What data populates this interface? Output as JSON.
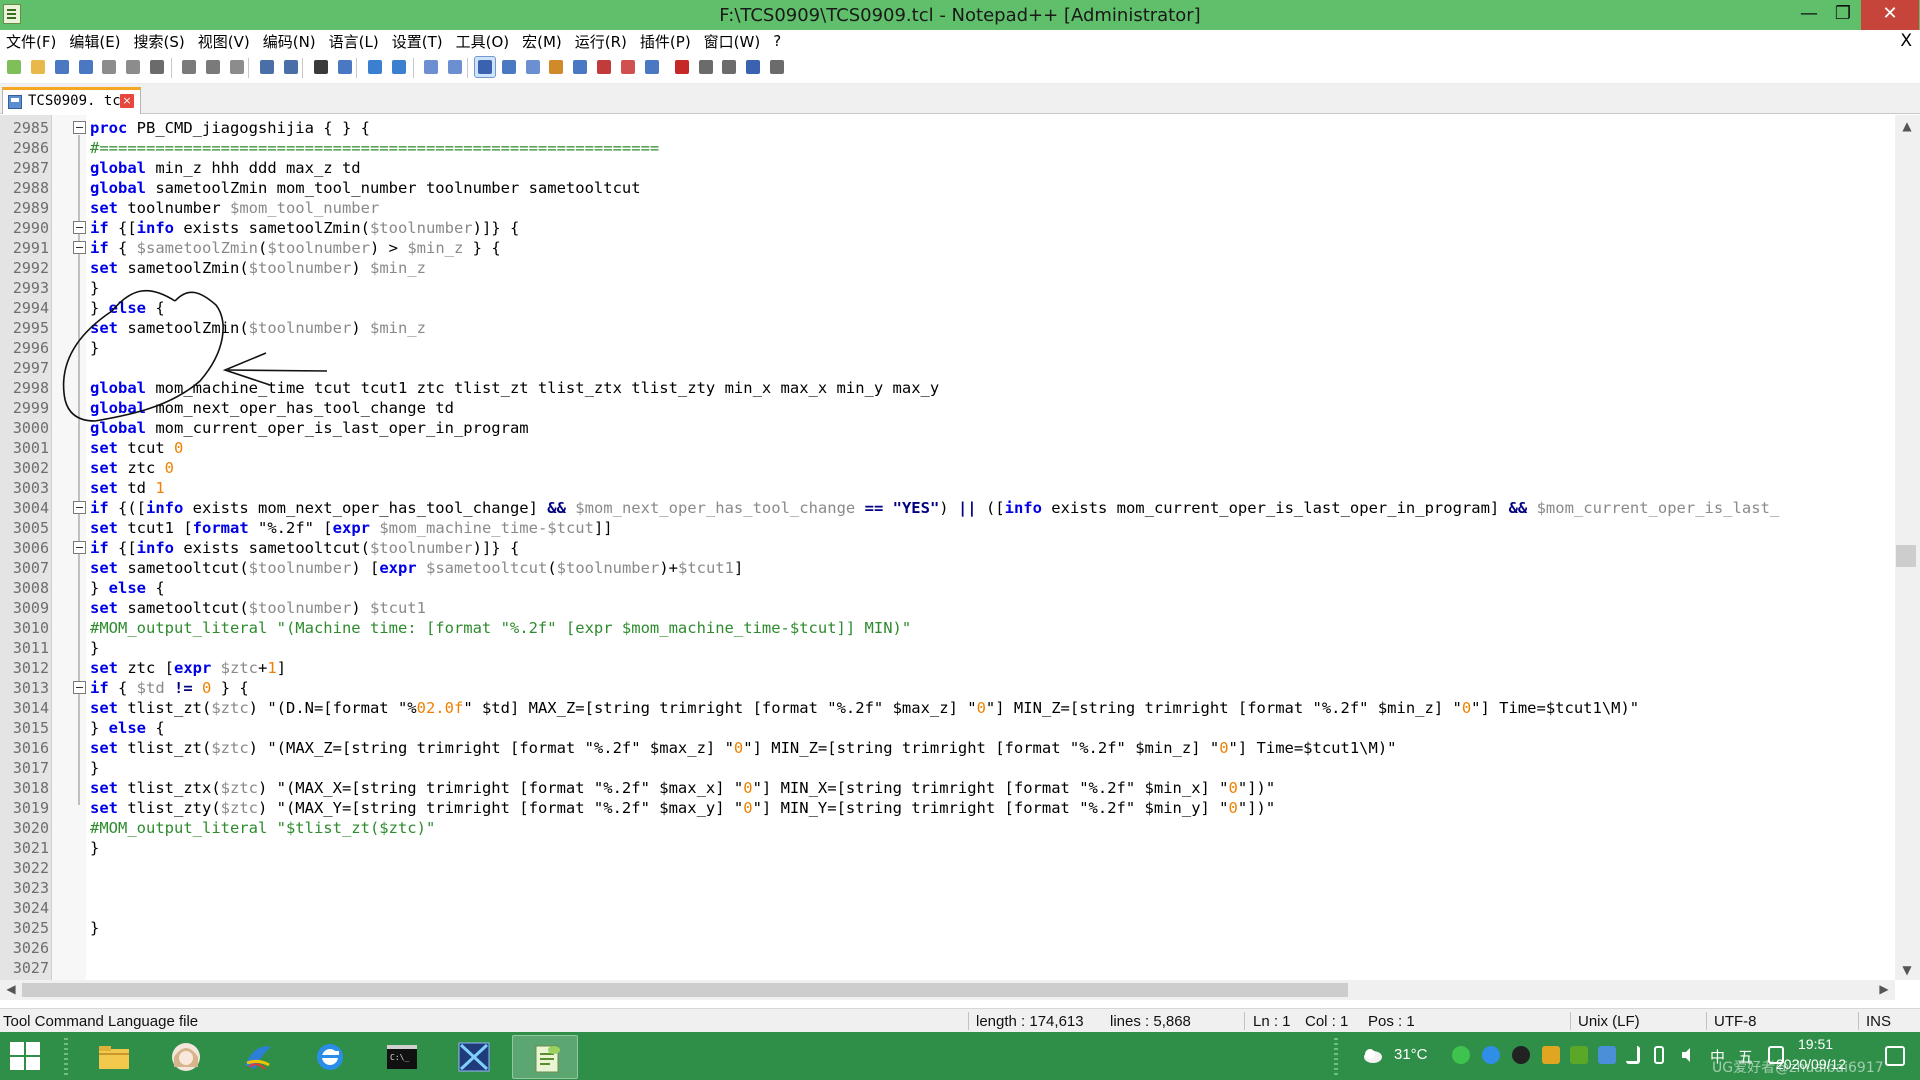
{
  "window": {
    "title": "F:\\TCS0909\\TCS0909.tcl - Notepad++ [Administrator]",
    "min_glyph": "—",
    "max_glyph": "❐",
    "close_glyph": "✕"
  },
  "menu": {
    "items": [
      "文件(F)",
      "编辑(E)",
      "搜索(S)",
      "视图(V)",
      "编码(N)",
      "语言(L)",
      "设置(T)",
      "工具(O)",
      "宏(M)",
      "运行(R)",
      "插件(P)",
      "窗口(W)",
      "?"
    ],
    "close_glyph": "X"
  },
  "tab": {
    "label": "TCS0909. tcl",
    "close_glyph": "×"
  },
  "editor": {
    "lines": [
      {
        "n": "2985",
        "fold": true
      },
      {
        "n": "2986",
        "fold": false
      },
      {
        "n": "2987",
        "fold": false
      },
      {
        "n": "2988",
        "fold": false
      },
      {
        "n": "2989",
        "fold": false
      },
      {
        "n": "2990",
        "fold": true
      },
      {
        "n": "2991",
        "fold": true
      },
      {
        "n": "2992",
        "fold": false
      },
      {
        "n": "2993",
        "fold": false
      },
      {
        "n": "2994",
        "fold": false
      },
      {
        "n": "2995",
        "fold": false
      },
      {
        "n": "2996",
        "fold": false
      },
      {
        "n": "2997",
        "fold": false
      },
      {
        "n": "2998",
        "fold": false
      },
      {
        "n": "2999",
        "fold": false
      },
      {
        "n": "3000",
        "fold": false
      },
      {
        "n": "3001",
        "fold": false
      },
      {
        "n": "3002",
        "fold": false
      },
      {
        "n": "3003",
        "fold": false
      },
      {
        "n": "3004",
        "fold": true
      },
      {
        "n": "3005",
        "fold": false
      },
      {
        "n": "3006",
        "fold": true
      },
      {
        "n": "3007",
        "fold": false
      },
      {
        "n": "3008",
        "fold": false
      },
      {
        "n": "3009",
        "fold": false
      },
      {
        "n": "3010",
        "fold": false
      },
      {
        "n": "3011",
        "fold": false
      },
      {
        "n": "3012",
        "fold": false
      },
      {
        "n": "3013",
        "fold": true
      },
      {
        "n": "3014",
        "fold": false
      },
      {
        "n": "3015",
        "fold": false
      },
      {
        "n": "3016",
        "fold": false
      },
      {
        "n": "3017",
        "fold": false
      },
      {
        "n": "3018",
        "fold": false
      },
      {
        "n": "3019",
        "fold": false
      },
      {
        "n": "3020",
        "fold": false
      },
      {
        "n": "3021",
        "fold": false
      },
      {
        "n": "3022",
        "fold": false
      },
      {
        "n": "3023",
        "fold": false
      },
      {
        "n": "3024",
        "fold": false
      },
      {
        "n": "3025",
        "fold": false
      },
      {
        "n": "3026",
        "fold": false
      },
      {
        "n": "3027",
        "fold": false
      }
    ],
    "code": [
      [
        [
          "kw",
          "proc"
        ],
        [
          "t",
          " PB_CMD_jiagogshijia { } {"
        ]
      ],
      [
        [
          "cmt",
          "#============================================================"
        ]
      ],
      [
        [
          "kw",
          "global"
        ],
        [
          "t",
          " min_z hhh ddd max_z td"
        ]
      ],
      [
        [
          "kw",
          "global"
        ],
        [
          "t",
          " sametoolZmin mom_tool_number toolnumber sametooltcut"
        ]
      ],
      [
        [
          "kw",
          "set"
        ],
        [
          "t",
          " toolnumber "
        ],
        [
          "var",
          "$mom_tool_number"
        ]
      ],
      [
        [
          "kw",
          "if"
        ],
        [
          "t",
          " {["
        ],
        [
          "kw",
          "info"
        ],
        [
          "t",
          " exists sametoolZmin("
        ],
        [
          "var",
          "$toolnumber"
        ],
        [
          "t",
          ")]} {"
        ]
      ],
      [
        [
          "kw",
          "if"
        ],
        [
          "t",
          " { "
        ],
        [
          "var",
          "$sametoolZmin"
        ],
        [
          "t",
          "("
        ],
        [
          "var",
          "$toolnumber"
        ],
        [
          "t",
          ") > "
        ],
        [
          "var",
          "$min_z"
        ],
        [
          "t",
          " } {"
        ]
      ],
      [
        [
          "kw",
          "set"
        ],
        [
          "t",
          " sametoolZmin("
        ],
        [
          "var",
          "$toolnumber"
        ],
        [
          "t",
          ") "
        ],
        [
          "var",
          "$min_z"
        ]
      ],
      [
        [
          "t",
          "}"
        ]
      ],
      [
        [
          "t",
          "} "
        ],
        [
          "kw",
          "else"
        ],
        [
          "t",
          " {"
        ]
      ],
      [
        [
          "kw",
          "set"
        ],
        [
          "t",
          " sametoolZmin("
        ],
        [
          "var",
          "$toolnumber"
        ],
        [
          "t",
          ") "
        ],
        [
          "var",
          "$min_z"
        ]
      ],
      [
        [
          "t",
          "}"
        ]
      ],
      [
        [
          "t",
          ""
        ]
      ],
      [
        [
          "kw",
          "global"
        ],
        [
          "t",
          " mom_machine_time tcut tcut1 ztc tlist_zt tlist_ztx tlist_zty min_x max_x min_y max_y"
        ]
      ],
      [
        [
          "kw",
          "global"
        ],
        [
          "t",
          " mom_next_oper_has_tool_change td"
        ]
      ],
      [
        [
          "kw",
          "global"
        ],
        [
          "t",
          " mom_current_oper_is_last_oper_in_program"
        ]
      ],
      [
        [
          "kw",
          "set"
        ],
        [
          "t",
          " tcut "
        ],
        [
          "num",
          "0"
        ]
      ],
      [
        [
          "kw",
          "set"
        ],
        [
          "t",
          " ztc "
        ],
        [
          "num",
          "0"
        ]
      ],
      [
        [
          "kw",
          "set"
        ],
        [
          "t",
          " td "
        ],
        [
          "num",
          "1"
        ]
      ],
      [
        [
          "kw",
          "if"
        ],
        [
          "t",
          " {(["
        ],
        [
          "kw",
          "info"
        ],
        [
          "t",
          " exists mom_next_oper_has_tool_change] "
        ],
        [
          "op",
          "&&"
        ],
        [
          "t",
          " "
        ],
        [
          "var",
          "$mom_next_oper_has_tool_change"
        ],
        [
          "t",
          " "
        ],
        [
          "op",
          "=="
        ],
        [
          "t",
          " "
        ],
        [
          "op",
          "\"YES\""
        ],
        [
          "t",
          ") "
        ],
        [
          "op",
          "||"
        ],
        [
          "t",
          " (["
        ],
        [
          "kw",
          "info"
        ],
        [
          "t",
          " exists mom_current_oper_is_last_oper_in_program] "
        ],
        [
          "op",
          "&&"
        ],
        [
          "t",
          " "
        ],
        [
          "var",
          "$mom_current_oper_is_last_"
        ]
      ],
      [
        [
          "kw",
          "set"
        ],
        [
          "t",
          " tcut1 ["
        ],
        [
          "kw",
          "format"
        ],
        [
          "t",
          " \"%.2f\" ["
        ],
        [
          "kw",
          "expr"
        ],
        [
          "t",
          " "
        ],
        [
          "var",
          "$mom_machine_time-$tcut"
        ],
        [
          "t",
          "]]"
        ]
      ],
      [
        [
          "kw",
          "if"
        ],
        [
          "t",
          " {["
        ],
        [
          "kw",
          "info"
        ],
        [
          "t",
          " exists sametooltcut("
        ],
        [
          "var",
          "$toolnumber"
        ],
        [
          "t",
          ")]} {"
        ]
      ],
      [
        [
          "kw",
          "set"
        ],
        [
          "t",
          " sametooltcut("
        ],
        [
          "var",
          "$toolnumber"
        ],
        [
          "t",
          ") ["
        ],
        [
          "kw",
          "expr"
        ],
        [
          "t",
          " "
        ],
        [
          "var",
          "$sametooltcut"
        ],
        [
          "t",
          "("
        ],
        [
          "var",
          "$toolnumber"
        ],
        [
          "t",
          ")+"
        ],
        [
          "var",
          "$tcut1"
        ],
        [
          "t",
          "]"
        ]
      ],
      [
        [
          "t",
          "} "
        ],
        [
          "kw",
          "else"
        ],
        [
          "t",
          " {"
        ]
      ],
      [
        [
          "kw",
          "set"
        ],
        [
          "t",
          " sametooltcut("
        ],
        [
          "var",
          "$toolnumber"
        ],
        [
          "t",
          ") "
        ],
        [
          "var",
          "$tcut1"
        ]
      ],
      [
        [
          "cmt",
          "#MOM_output_literal \"(Machine time: [format \"%.2f\" [expr $mom_machine_time-$tcut]] MIN)\""
        ]
      ],
      [
        [
          "t",
          "}"
        ]
      ],
      [
        [
          "kw",
          "set"
        ],
        [
          "t",
          " ztc ["
        ],
        [
          "kw",
          "expr"
        ],
        [
          "t",
          " "
        ],
        [
          "var",
          "$ztc"
        ],
        [
          "t",
          "+"
        ],
        [
          "num",
          "1"
        ],
        [
          "t",
          "]"
        ]
      ],
      [
        [
          "kw",
          "if"
        ],
        [
          "t",
          " { "
        ],
        [
          "var",
          "$td"
        ],
        [
          "t",
          " "
        ],
        [
          "op",
          "!="
        ],
        [
          "t",
          " "
        ],
        [
          "num",
          "0"
        ],
        [
          "t",
          " } {"
        ]
      ],
      [
        [
          "kw",
          "set"
        ],
        [
          "t",
          " tlist_zt("
        ],
        [
          "var",
          "$ztc"
        ],
        [
          "t",
          ") \"(D.N=[format \"%"
        ],
        [
          "num",
          "02.0f"
        ],
        [
          "t",
          "\" $td] MAX_Z=[string trimright [format \"%.2f\" $max_z] \""
        ],
        [
          "num",
          "0"
        ],
        [
          "t",
          "\"] MIN_Z=[string trimright [format \"%.2f\" $min_z] \""
        ],
        [
          "num",
          "0"
        ],
        [
          "t",
          "\"] Time=$tcut1\\M)\""
        ]
      ],
      [
        [
          "t",
          "} "
        ],
        [
          "kw",
          "else"
        ],
        [
          "t",
          " {"
        ]
      ],
      [
        [
          "kw",
          "set"
        ],
        [
          "t",
          " tlist_zt("
        ],
        [
          "var",
          "$ztc"
        ],
        [
          "t",
          ") \"(MAX_Z=[string trimright [format \"%.2f\" $max_z] \""
        ],
        [
          "num",
          "0"
        ],
        [
          "t",
          "\"] MIN_Z=[string trimright [format \"%.2f\" $min_z] \""
        ],
        [
          "num",
          "0"
        ],
        [
          "t",
          "\"] Time=$tcut1\\M)\""
        ]
      ],
      [
        [
          "t",
          "}"
        ]
      ],
      [
        [
          "kw",
          "set"
        ],
        [
          "t",
          " tlist_ztx("
        ],
        [
          "var",
          "$ztc"
        ],
        [
          "t",
          ") \"(MAX_X=[string trimright [format \"%.2f\" $max_x] \""
        ],
        [
          "num",
          "0"
        ],
        [
          "t",
          "\"] MIN_X=[string trimright [format \"%.2f\" $min_x] \""
        ],
        [
          "num",
          "0"
        ],
        [
          "t",
          "\"])\""
        ]
      ],
      [
        [
          "kw",
          "set"
        ],
        [
          "t",
          " tlist_zty("
        ],
        [
          "var",
          "$ztc"
        ],
        [
          "t",
          ") \"(MAX_Y=[string trimright [format \"%.2f\" $max_y] \""
        ],
        [
          "num",
          "0"
        ],
        [
          "t",
          "\"] MIN_Y=[string trimright [format \"%.2f\" $min_y] \""
        ],
        [
          "num",
          "0"
        ],
        [
          "t",
          "\"])\""
        ]
      ],
      [
        [
          "cmt",
          "#MOM_output_literal \"$tlist_zt($ztc)\""
        ]
      ],
      [
        [
          "t",
          "}"
        ]
      ],
      [
        [
          "t",
          ""
        ]
      ],
      [
        [
          "t",
          ""
        ]
      ],
      [
        [
          "t",
          ""
        ]
      ],
      [
        [
          "t",
          "}"
        ]
      ],
      [
        [
          "t",
          ""
        ]
      ],
      [
        [
          "t",
          ""
        ]
      ]
    ]
  },
  "statusbar": {
    "language": "Tool Command Language file",
    "length": "length : 174,613",
    "lines": "lines : 5,868",
    "ln": "Ln : 1",
    "col": "Col : 1",
    "pos": "Pos : 1",
    "eol": "Unix (LF)",
    "encoding": "UTF-8",
    "mode": "INS"
  },
  "taskbar": {
    "weather": "31°C",
    "ime_lang": "中",
    "ime_mode": "五",
    "time": "19:51",
    "date": "2020/09/12",
    "watermark": "UG爱好者@zhuaibai6917"
  },
  "colors": {
    "titlebar": "#5fbf6a",
    "taskbar": "#2f8f49",
    "keyword": "#0000e6",
    "variable": "#8a8a8a",
    "number": "#f08000",
    "comment": "#2e8b2e",
    "tab_accent": "#f5a623"
  },
  "icons": {
    "toolbar": [
      "new-file-icon",
      "open-file-icon",
      "save-icon",
      "save-all-icon",
      "close-icon",
      "close-all-icon",
      "print-icon",
      "cut-icon",
      "copy-icon",
      "paste-icon",
      "undo-icon",
      "redo-icon",
      "find-icon",
      "replace-icon",
      "zoom-in-icon",
      "zoom-out-icon",
      "sync-vertical-icon",
      "sync-horizontal-icon",
      "word-wrap-icon",
      "show-all-chars-icon",
      "indent-guide-icon",
      "udl-icon",
      "doc-map-icon",
      "function-list-icon",
      "folder-workspace-icon",
      "monitor-icon",
      "record-macro-icon",
      "stop-record-icon",
      "play-macro-icon",
      "run-macro-multiple-icon",
      "save-macro-icon"
    ]
  }
}
